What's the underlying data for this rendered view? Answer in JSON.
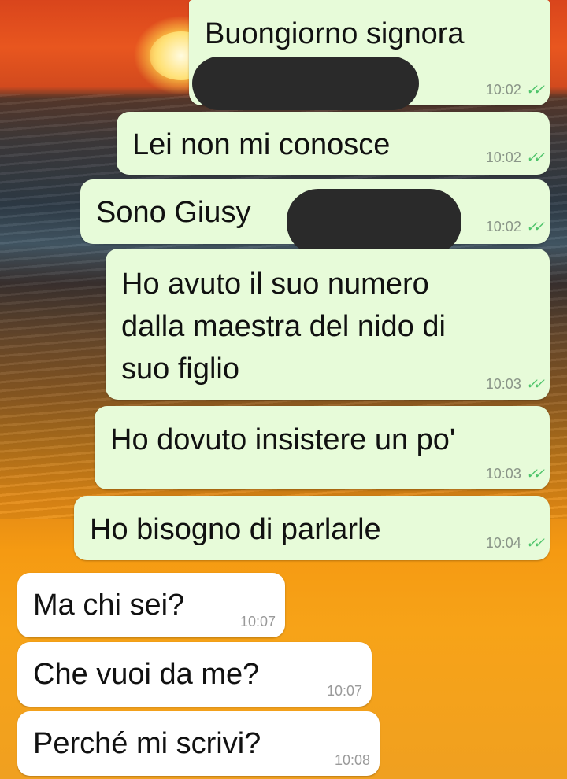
{
  "messages": [
    {
      "id": "m1",
      "direction": "outgoing",
      "text": "Buongiorno signora",
      "time": "10:02",
      "status": "read",
      "redacted": true
    },
    {
      "id": "m2",
      "direction": "outgoing",
      "text": "Lei non mi conosce",
      "time": "10:02",
      "status": "read"
    },
    {
      "id": "m3",
      "direction": "outgoing",
      "text": "Sono Giusy",
      "time": "10:02",
      "status": "read",
      "redacted": true
    },
    {
      "id": "m4",
      "direction": "outgoing",
      "lines": [
        "Ho avuto il suo numero",
        "dalla maestra del nido di",
        "suo figlio"
      ],
      "time": "10:03",
      "status": "read"
    },
    {
      "id": "m5",
      "direction": "outgoing",
      "text": "Ho dovuto insistere un po'",
      "time": "10:03",
      "status": "read"
    },
    {
      "id": "m6",
      "direction": "outgoing",
      "text": "Ho bisogno di parlarle",
      "time": "10:04",
      "status": "read"
    },
    {
      "id": "m7",
      "direction": "incoming",
      "text": "Ma chi sei?",
      "time": "10:07"
    },
    {
      "id": "m8",
      "direction": "incoming",
      "text": "Che vuoi da me?",
      "time": "10:07"
    },
    {
      "id": "m9",
      "direction": "incoming",
      "text": "Perché mi scrivi?",
      "time": "10:08"
    }
  ],
  "icons": {
    "read_receipt": "double-check-icon"
  },
  "colors": {
    "outgoing_bubble": "#e7fbd9",
    "incoming_bubble": "#ffffff",
    "read_ticks": "#4fc46b",
    "timestamp": "#8a9588"
  }
}
